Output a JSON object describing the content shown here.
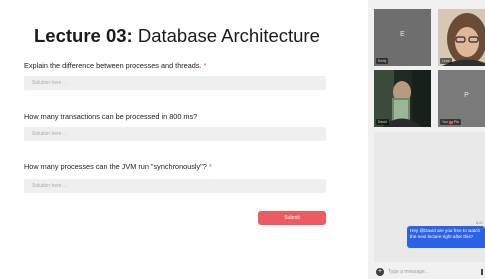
{
  "quiz": {
    "title_bold": "Lecture 03:",
    "title_rest": " Database Architecture",
    "questions": [
      {
        "text": "Explain the difference between processes and threads.",
        "required": "*",
        "placeholder": "Solution here ..."
      },
      {
        "text": "How many transactions can be processed in 800 ms?",
        "required": "",
        "placeholder": "Solution here ..."
      },
      {
        "text": "How many processes can the JVM run \"synchronously\"?",
        "required": "*",
        "placeholder": "Solution here ..."
      }
    ],
    "submit_label": "Submit"
  },
  "participants": [
    {
      "initial": "E",
      "label": "Emily"
    },
    {
      "initial": "",
      "label": "Lena"
    },
    {
      "initial": "",
      "label": "David"
    },
    {
      "initial": "P",
      "label_prefix": "You",
      "label": "Pia"
    }
  ],
  "chat": {
    "time": "8:41",
    "message": "Hey @David are you free to watch the next lecture right after this?",
    "input_placeholder": "Type a message..."
  },
  "colors": {
    "accent": "#ee5a62",
    "chat_bubble": "#2c63e6",
    "required_marker": "#e8475a"
  }
}
